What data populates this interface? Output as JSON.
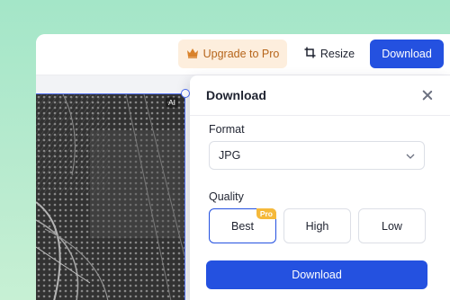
{
  "toolbar": {
    "upgrade_label": "Upgrade to Pro",
    "upgrade_icon": "crown-icon",
    "resize_label": "Resize",
    "resize_icon": "crop-icon",
    "download_label": "Download"
  },
  "canvas": {
    "ai_badge": "AI"
  },
  "panel": {
    "title": "Download",
    "format": {
      "label": "Format",
      "selected": "JPG"
    },
    "quality": {
      "label": "Quality",
      "options": [
        {
          "label": "Best",
          "badge": "Pro",
          "selected": true
        },
        {
          "label": "High",
          "selected": false
        },
        {
          "label": "Low",
          "selected": false
        }
      ]
    },
    "download_label": "Download"
  },
  "colors": {
    "accent": "#2451e0",
    "upgrade_bg": "#fdeedd",
    "upgrade_text": "#b6651b",
    "pro_badge": "#f5b93a",
    "background": "#a4e6c8"
  }
}
